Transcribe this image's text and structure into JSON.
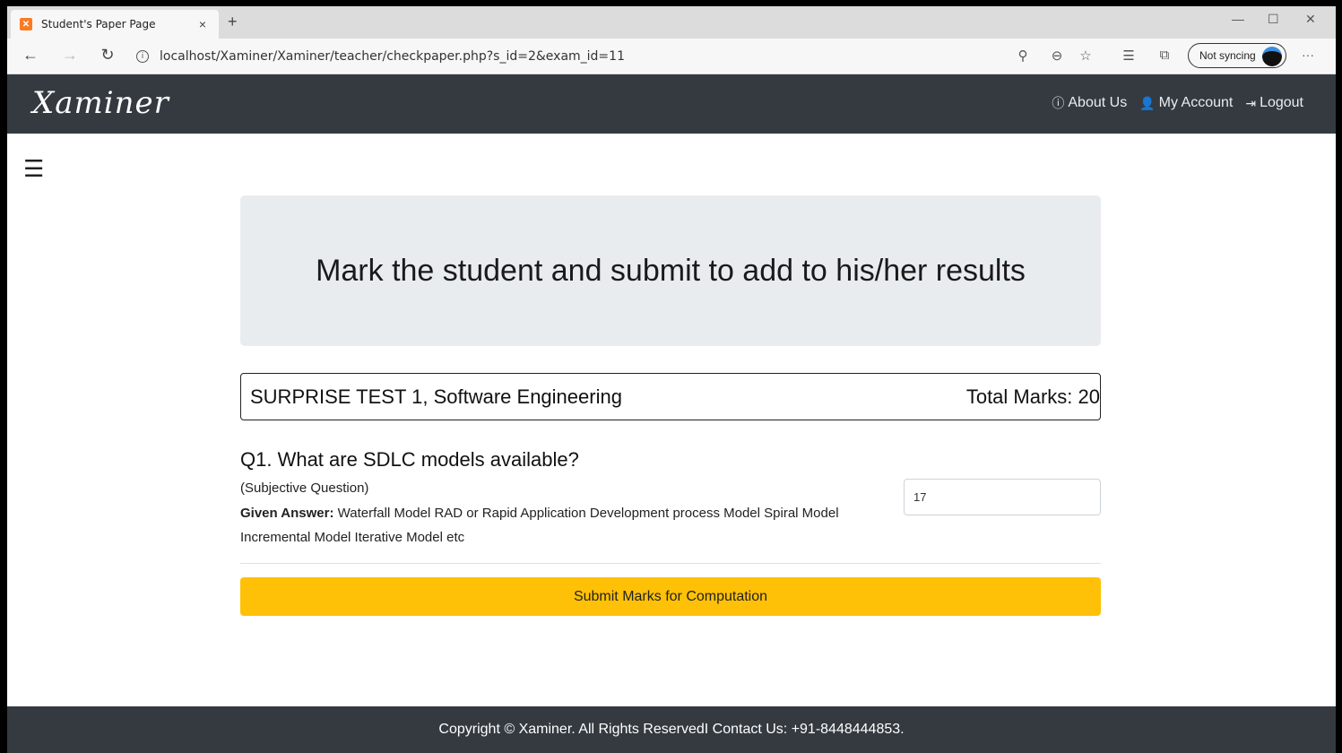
{
  "browser": {
    "tab_title": "Student's Paper Page",
    "tab_close": "×",
    "new_tab": "+",
    "url": "localhost/Xaminer/Xaminer/teacher/checkpaper.php?s_id=2&exam_id=11",
    "sync_label": "Not syncing",
    "icons": [
      "back-icon",
      "forward-icon",
      "refresh-icon",
      "info-icon",
      "search-icon",
      "zoom-icon",
      "favorite-icon",
      "favorites-list-icon",
      "collections-icon",
      "more-icon"
    ]
  },
  "navbar": {
    "brand": "Xaminer",
    "links": [
      {
        "label": "About Us",
        "icon": "info-circle-icon"
      },
      {
        "label": "My Account",
        "icon": "user-icon"
      },
      {
        "label": "Logout",
        "icon": "logout-icon"
      }
    ]
  },
  "main": {
    "heading": "Mark the student and submit to add to his/her results",
    "exam_name": "SURPRISE TEST 1, Software Engineering",
    "total_marks": "Total Marks: 20",
    "questions": [
      {
        "title": "Q1. What are SDLC models available?",
        "type": "(Subjective Question)",
        "answer_label": "Given Answer:",
        "answer": "Waterfall Model RAD or Rapid Application Development process Model Spiral Model Incremental Model Iterative Model etc",
        "marks_value": "17"
      }
    ],
    "submit_label": "Submit Marks for Computation"
  },
  "footer": {
    "text": "Copyright © Xaminer. All Rights ReservedI Contact Us: +91-8448444853."
  }
}
